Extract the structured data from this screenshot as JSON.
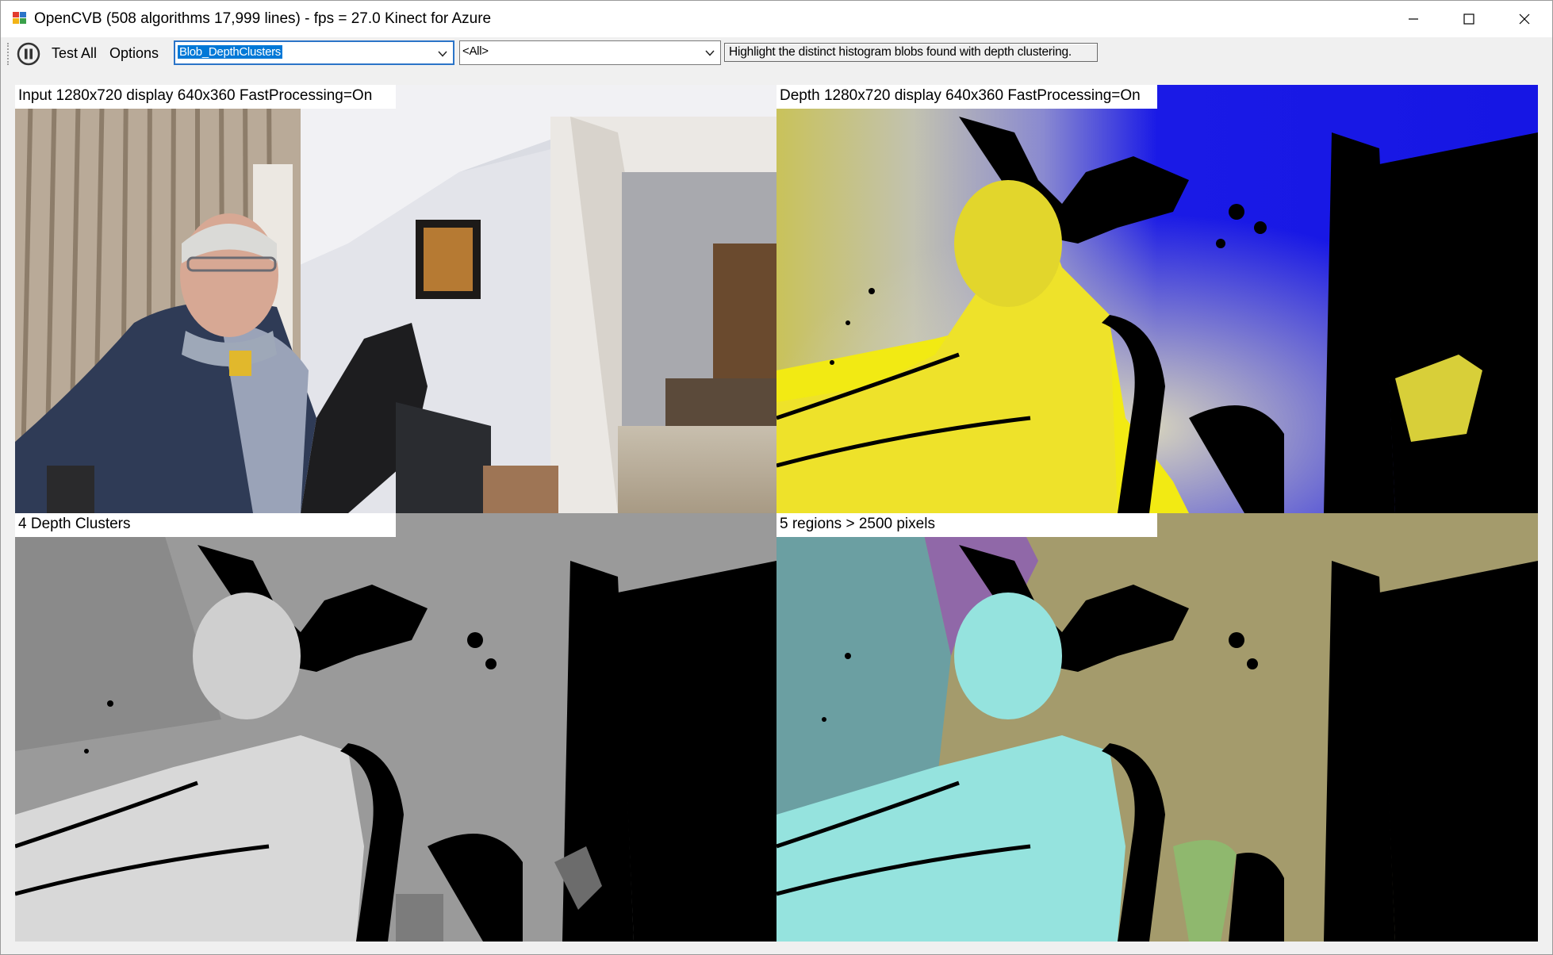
{
  "window": {
    "title": "OpenCVB (508 algorithms 17,999 lines) - fps = 27.0 Kinect for Azure",
    "app_icon": "opencvb-app-icon",
    "controls": {
      "minimize": "minimize-icon",
      "maximize": "maximize-icon",
      "close": "close-icon"
    }
  },
  "toolbar": {
    "pause_icon": "pause-icon",
    "test_all_label": "Test All",
    "options_label": "Options",
    "algorithm_select": {
      "value": "Blob_DepthClusters"
    },
    "group_select": {
      "value": "<All>"
    },
    "description": "Highlight the distinct histogram blobs found with depth clustering."
  },
  "panels": {
    "input": {
      "label": "Input  1280x720  display  640x360  FastProcessing=On"
    },
    "depth": {
      "label": "Depth  1280x720  display  640x360  FastProcessing=On"
    },
    "clusters": {
      "label": "4 Depth Clusters"
    },
    "regions": {
      "label": "5 regions > 2500 pixels"
    }
  },
  "colors": {
    "selection": "#0078d7",
    "focus_border": "#2b74c8",
    "depth_yellow": "#f5e51a",
    "depth_blue": "#1a1ae6",
    "region_teal": "#6b9fa2",
    "region_purple": "#9068a8",
    "region_cyan": "#95e3de",
    "region_khaki": "#a49b6c",
    "region_green": "#8fb86e"
  }
}
